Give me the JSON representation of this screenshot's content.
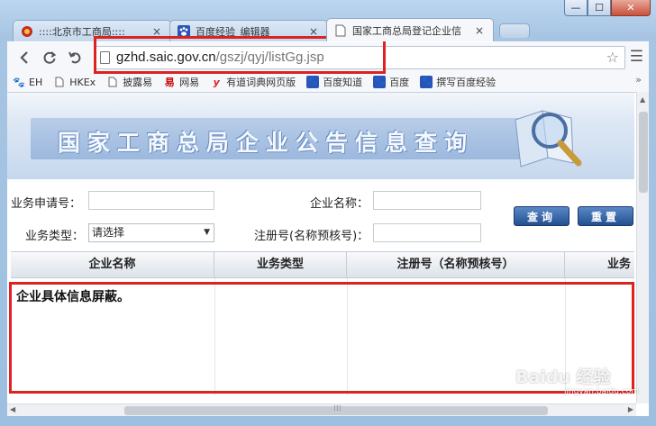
{
  "window": {
    "controls": {
      "minimize": "—",
      "maximize": "☐",
      "close": "✕"
    }
  },
  "tabs": [
    {
      "title": "::::北京市工商局::::",
      "icon": "emblem-icon",
      "close": "×"
    },
    {
      "title": "百度经验_编辑器",
      "icon": "paw-icon",
      "close": "×"
    },
    {
      "title": "国家工商总局登记企业信",
      "icon": "page-icon",
      "close": "×"
    }
  ],
  "toolbar": {
    "back": "‹",
    "reload": "↻",
    "undo": "↶",
    "url_host": "gzhd.saic.gov.cn",
    "url_path": "/gszj/qyj/listGg.jsp",
    "star": "☆",
    "menu": "☰"
  },
  "bookmarks": [
    {
      "label": "EH",
      "icon": "paw-icon"
    },
    {
      "label": "HKEx",
      "icon": "page-icon"
    },
    {
      "label": "披露易",
      "icon": "page-icon"
    },
    {
      "label": "网易",
      "icon": "netease-icon"
    },
    {
      "label": "有道词典网页版",
      "icon": "youdao-icon"
    },
    {
      "label": "百度知道",
      "icon": "paw-icon"
    },
    {
      "label": "百度",
      "icon": "paw-icon"
    },
    {
      "label": "撰写百度经验",
      "icon": "paw-icon"
    }
  ],
  "bookmarks_more": "»",
  "banner": {
    "title": "国家工商总局企业公告信息查询"
  },
  "form": {
    "application_no_label": "业务申请号：",
    "company_name_label": "企业名称：",
    "business_type_label": "业务类型：",
    "business_type_value": "请选择",
    "reg_no_label": "注册号(名称预核号)：",
    "query_button": "查询",
    "reset_button": "重置"
  },
  "table": {
    "headers": [
      "企业名称",
      "业务类型",
      "注册号（名称预核号）",
      "业务"
    ],
    "notice": "企业具体信息屏蔽。"
  },
  "watermark": {
    "text": "Baidu 经验",
    "sub": "jingyan.baidu.com"
  },
  "colors": {
    "accent": "#23508f",
    "highlight": "#dd2222"
  }
}
